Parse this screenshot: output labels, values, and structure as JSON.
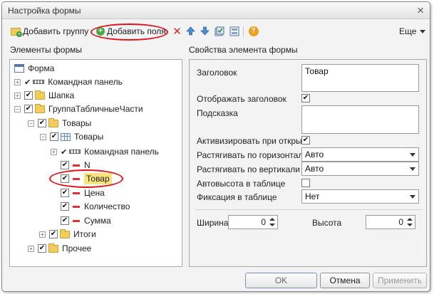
{
  "window": {
    "title": "Настройка формы"
  },
  "toolbar": {
    "add_group_label": "Добавить группу",
    "add_fields_label": "Добавить поля",
    "more_label": "Еще",
    "help_glyph": "?"
  },
  "left_panel": {
    "heading": "Элементы формы"
  },
  "right_panel": {
    "heading": "Свойства элемента формы"
  },
  "tree": [
    {
      "label": "Форма",
      "icon": "form-icon"
    },
    {
      "label": "Командная панель",
      "icon": "command-bar-icon"
    },
    {
      "label": "Шапка",
      "icon": "folder-icon"
    },
    {
      "label": "ГруппаТабличныеЧасти",
      "icon": "folder-icon"
    },
    {
      "label": "Товары",
      "icon": "folder-icon"
    },
    {
      "label": "Товары",
      "icon": "table-icon"
    },
    {
      "label": "Командная панель",
      "icon": "command-bar-icon"
    },
    {
      "label": "N",
      "icon": "field-icon"
    },
    {
      "label": "Товар",
      "icon": "field-icon"
    },
    {
      "label": "Цена",
      "icon": "field-icon"
    },
    {
      "label": "Количество",
      "icon": "field-icon"
    },
    {
      "label": "Сумма",
      "icon": "field-icon"
    },
    {
      "label": "Итоги",
      "icon": "folder-icon"
    },
    {
      "label": "Прочее",
      "icon": "folder-icon"
    }
  ],
  "properties": {
    "title_label": "Заголовок",
    "title_value": "Товар",
    "show_title_label": "Отображать заголовок",
    "show_title_checked": "✔",
    "hint_label": "Подсказка",
    "hint_value": "",
    "activate_label": "Активизировать при открыт",
    "activate_checked": "✔",
    "stretch_h_label": "Растягивать по горизонтал",
    "stretch_h_value": "Авто",
    "stretch_v_label": "Растягивать по вертикали",
    "stretch_v_value": "Авто",
    "autoheight_label": "Автовысота в таблице",
    "fix_label": "Фиксация в таблице",
    "fix_value": "Нет",
    "width_label": "Ширина",
    "width_value": "0",
    "height_label": "Высота",
    "height_value": "0"
  },
  "footer": {
    "ok_label": "OK",
    "cancel_label": "Отмена",
    "apply_label": "Применить"
  },
  "colors": {
    "annotation_red": "#e0131b",
    "selection_highlight": "#f7e47a"
  }
}
